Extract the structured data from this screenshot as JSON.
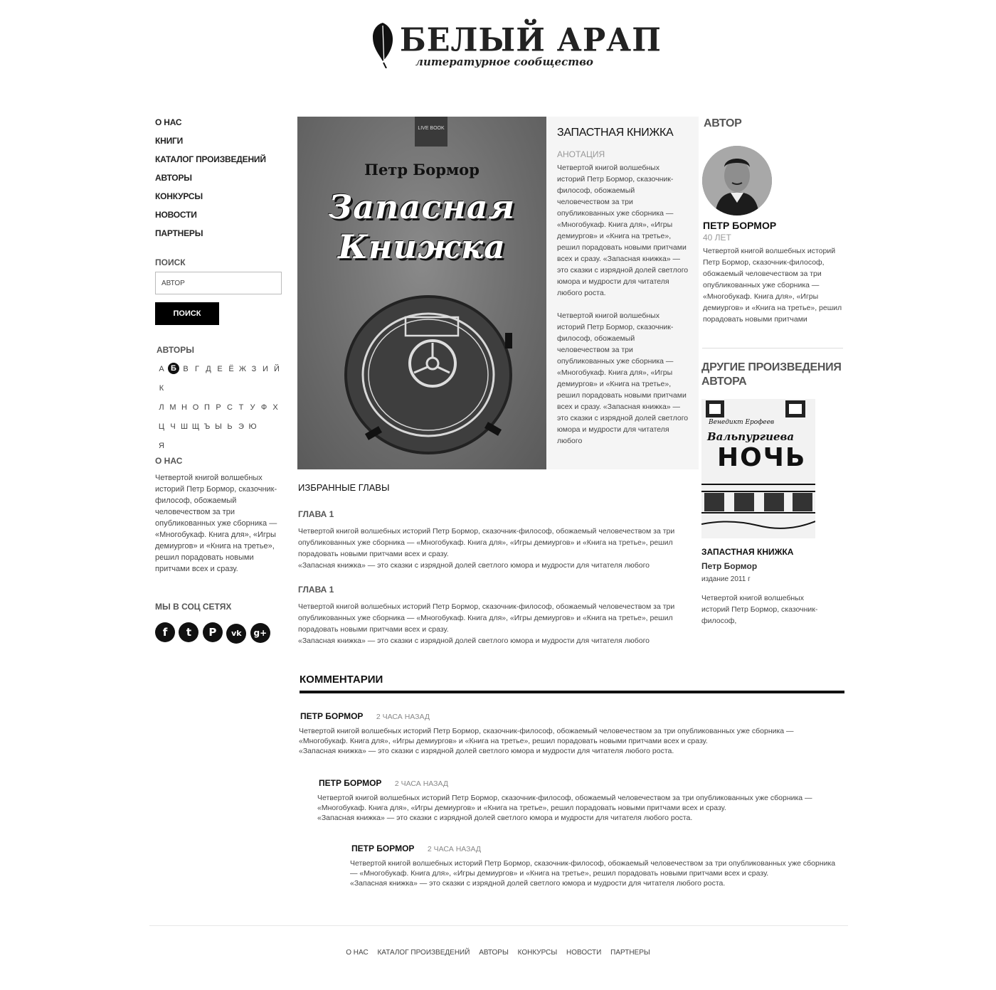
{
  "logo": {
    "title": "БЕЛЫЙ АРАП",
    "subtitle": "литературное сообщество",
    "icon": "feather-icon"
  },
  "nav": {
    "items": [
      "О НАС",
      "КНИГИ",
      "КАТАЛОГ ПРОИЗВЕДЕНИЙ",
      "АВТОРЫ",
      "КОНКУРСЫ",
      "НОВОСТИ",
      "ПАРТНЕРЫ"
    ]
  },
  "search": {
    "heading": "ПОИСК",
    "value": "АВТОР",
    "button": "ПОИСК"
  },
  "authors_index": {
    "heading": "АВТОРЫ",
    "letters": [
      "А",
      "Б",
      "В",
      "Г",
      "Д",
      "Е",
      "Ё",
      "Ж",
      "З",
      "И",
      "Й",
      "К",
      "Л",
      "М",
      "Н",
      "О",
      "П",
      "Р",
      "С",
      "Т",
      "У",
      "Ф",
      "Х",
      "Ц",
      "Ч",
      "Ш",
      "Щ",
      "Ъ",
      "Ы",
      "Ь",
      "Э",
      "Ю",
      "Я"
    ],
    "active": "Б"
  },
  "about": {
    "heading": "О НАС",
    "text": "Четвертой книгой волшебных историй Петр Бормор, сказочник-философ, обожаемый человечеством за три опубликованных уже сборника — «Многобукаф. Книга для», «Игры демиургов» и «Книга на третье», решил порадовать новыми притчами всех и сразу."
  },
  "social": {
    "heading": "МЫ В СОЦ СЕТЯХ",
    "icons": [
      "facebook-icon",
      "twitter-icon",
      "pinterest-icon",
      "vk-icon",
      "google-plus-icon"
    ],
    "glyphs": [
      "f",
      "t",
      "P",
      "vk",
      "g+"
    ]
  },
  "cover": {
    "badge": "LIVE BOOK",
    "author": "Петр Бормор",
    "title_line1": "Запасная",
    "title_line2": "Книжка"
  },
  "annotation": {
    "title": "ЗАПАСТНАЯ КНИЖКА",
    "subtitle": "АНОТАЦИЯ",
    "text1": "Четвертой книгой волшебных историй Петр Бормор, сказочник-философ, обожаемый человечеством за три опубликованных уже сборника — «Многобукаф. Книга для», «Игры демиургов» и «Книга на третье», решил порадовать новыми притчами всех и сразу. «Запасная книжка» — это сказки с изрядной долей светлого юмора и мудрости для читателя любого роста.",
    "text2": "Четвертой книгой волшебных историй Петр Бормор, сказочник-философ, обожаемый человечеством за три опубликованных уже сборника — «Многобукаф. Книга для», «Игры демиургов» и «Книга на третье», решил порадовать новыми притчами всех и сразу. «Запасная книжка» — это сказки с изрядной долей светлого юмора и мудрости для читателя любого"
  },
  "author_card": {
    "heading": "АВТОР",
    "name": "ПЕТР БОРМОР",
    "age": "40 ЛЕТ",
    "bio": "Четвертой книгой волшебных историй Петр Бормор, сказочник-философ, обожаемый человечеством за три опубликованных уже сборника — «Многобукаф. Книга для», «Игры демиургов» и «Книга на третье», решил порадовать новыми притчами"
  },
  "other_works": {
    "heading": "ДРУГИЕ ПРОИЗВЕДЕНИЯ АВТОРА",
    "thumb_author": "Венедикт Ерофеев",
    "thumb_title1": "Вальпургиева",
    "thumb_title2": "НОЧЬ",
    "book_title": "ЗАПАСТНАЯ КНИЖКА",
    "book_author": "Петр Бормор",
    "edition": "издание 2011 г",
    "text": "Четвертой книгой волшебных историй Петр Бормор, сказочник-философ,"
  },
  "chapters": {
    "heading": "ИЗБРАННЫЕ ГЛАВЫ",
    "items": [
      {
        "title": "ГЛАВА 1",
        "text": "Четвертой книгой волшебных историй Петр Бормор, сказочник-философ, обожаемый человечеством за три опубликованных уже сборника — «Многобукаф. Книга для», «Игры демиургов» и «Книга на третье», решил порадовать новыми притчами всех и сразу.",
        "text2": "«Запасная книжка» — это сказки с изрядной долей светлого юмора и мудрости для читателя любого"
      },
      {
        "title": "ГЛАВА 1",
        "text": "Четвертой книгой волшебных историй Петр Бормор, сказочник-философ, обожаемый человечеством за три опубликованных уже сборника — «Многобукаф. Книга для», «Игры демиургов» и «Книга на третье», решил порадовать новыми притчами всех и сразу.",
        "text2": "«Запасная книжка» — это сказки с изрядной долей светлого юмора и мудрости для читателя любого"
      }
    ]
  },
  "comments": {
    "heading": "КОММЕНТАРИИ",
    "items": [
      {
        "name": "ПЕТР БОРМОР",
        "time": "2 ЧАСА НАЗАД",
        "text": "Четвертой книгой волшебных историй Петр Бормор, сказочник-философ, обожаемый человечеством за три опубликованных уже сборника — «Многобукаф. Книга для», «Игры демиургов» и «Книга на третье», решил порадовать новыми притчами всех и сразу.",
        "text2": "«Запасная книжка» — это сказки с изрядной долей светлого юмора и мудрости для читателя любого роста."
      },
      {
        "name": "ПЕТР БОРМОР",
        "time": "2 ЧАСА НАЗАД",
        "text": "Четвертой книгой волшебных историй Петр Бормор, сказочник-философ, обожаемый человечеством за три опубликованных уже сборника — «Многобукаф. Книга для», «Игры демиургов» и «Книга на третье», решил порадовать новыми притчами всех и сразу.",
        "text2": "«Запасная книжка» — это сказки с изрядной долей светлого юмора и мудрости для читателя любого роста."
      },
      {
        "name": "ПЕТР БОРМОР",
        "time": "2 ЧАСА НАЗАД",
        "text": "Четвертой книгой волшебных историй Петр Бормор, сказочник-философ, обожаемый человечеством за три опубликованных уже сборника — «Многобукаф. Книга для», «Игры демиургов» и «Книга на третье», решил порадовать новыми притчами всех и сразу.",
        "text2": "«Запасная книжка» — это сказки с изрядной долей светлого юмора и мудрости для читателя любого роста."
      }
    ]
  },
  "footer": {
    "links": [
      "О НАС",
      "КАТАЛОГ ПРОИЗВЕДЕНИЙ",
      "АВТОРЫ",
      "КОНКУРСЫ",
      "НОВОСТИ",
      "ПАРТНЕРЫ"
    ]
  }
}
